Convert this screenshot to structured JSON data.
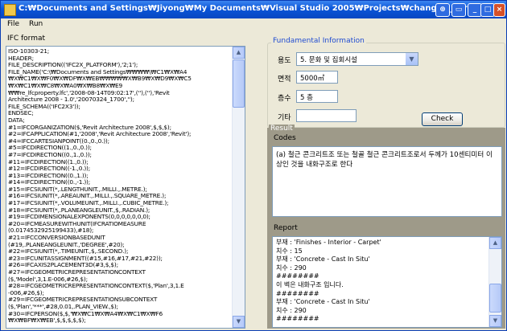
{
  "window": {
    "title": "C:\\Documents and Settings\\Jiyong\\My Documents\\Visual Studio 2005\\Projects\\changed_parame",
    "title_display": "C:₩Documents and Settings₩Jiyong₩My Documents₩Visual Studio 2005₩Projects₩changed_parame"
  },
  "menu": {
    "file": "File",
    "run": "Run"
  },
  "ifc": {
    "label": "IFC format",
    "lines": [
      "ISO-10303-21;",
      "HEADER;",
      "FILE_DESCRIPTION(('IFC2X_PLATFORM'),'2;1');",
      "FILE_NAME('C:\\₩Documents and Settings₩₩₩₩\\₩C1₩X₩A4",
      "₩X₩C1₩X₩F0₩X₩DF₩X₩EB₩₩₩₩₩X₩B9₩X₩D9₩X₩C5",
      "₩X₩C1₩X₩C8₩X₩A0₩X₩B8₩X₩E9",
      "₩₩re_lfcproperty.lfc','2008-08-14T09:02:17',(''),(''),'Revit",
      "Architecture 2008 - 1.0','20070324_1700','');",
      "FILE_SCHEMA(('IFC2X3'));",
      "ENDSEC;",
      "DATA;",
      "#1=IFCORGANIZATION($,'Revit Architecture 2008',$,$,$);",
      "#2=IFCAPPLICATION(#1,'2008','Revit Architecture 2008','Revit');",
      "#4=IFCCARTESIANPOINT((0.,0.,0.));",
      "#5=IFCDIRECTION((1.,0.,0.));",
      "#7=IFCDIRECTION((0.,1.,0.));",
      "#11=IFCDIRECTION((1.,0.));",
      "#12=IFCDIRECTION((-1.,0.));",
      "#13=IFCDIRECTION((0.,1.));",
      "#14=IFCDIRECTION((0.,-1.));",
      "#15=IFCSIUNIT(*,.LENGTHUNIT.,.MILLI.,.METRE.);",
      "#16=IFCSIUNIT(*,.AREAUNIT.,.MILLI.,.SQUARE_METRE.);",
      "#17=IFCSIUNIT(*,.VOLUMEUNIT.,.MILLI.,.CUBIC_METRE.);",
      "#18=IFCSIUNIT(*,.PLANEANGLEUNIT.,$,.RADIAN.);",
      "#19=IFCDIMENSIONALEXPONENTS(0,0,0,0,0,0,0);",
      "#20=IFCMEASUREWITHUNIT(IFCRATIOMEASURE",
      "(0.0174532925199433),#18);",
      "#21=IFCCONVERSIONBASEDUNIT",
      "(#19,.PLANEANGLEUNIT.,'DEGREE',#20);",
      "#22=IFCSIUNIT(*,.TIMEUNIT.,$,.SECOND.);",
      "#23=IFCUNITASSIGNMENT((#15,#16,#17,#21,#22));",
      "#26=IFCAXIS2PLACEMENT3D(#3,$,$);",
      "#27=IFCGEOMETRICREPRESENTATIONCONTEXT",
      "($,'Model',3,1.E-006,#26,$);",
      "#28=IFCGEOMETRICREPRESENTATIONCONTEXT($,'Plan',3,1.E",
      "-006,#26,$);",
      "#29=IFCGEOMETRICREPRESENTATIONSUBCONTEXT",
      "($,'Plan','***',#28,0.01,.PLAN_VIEW.,$);",
      "#30=IFCPERSON($,$,'₩X₩C1₩X₩A4₩X₩C1₩X₩F6",
      "₩X₩BF₩X₩EB',$,$,$,$,$);"
    ]
  },
  "fundamental": {
    "title": "Fundamental Information",
    "use_label": "용도",
    "use_value": "5. 문화 및 집회시설",
    "area_label": "면적",
    "area_value": "5000㎡",
    "floors_label": "층수",
    "floors_value": "5 층",
    "other_label": "기타",
    "other_value": "",
    "check_button": "Check"
  },
  "result": {
    "title": "Result",
    "codes_label": "Codes",
    "codes_text": "(a) 철근 콘크리트조 또는 철골 철근 콘크리트조로서 두께가 10센티미터 이상인 것을 내화구조로 한다",
    "report_label": "Report",
    "report_lines": [
      "부재 : 'Finishes - Interior - Carpet'",
      "치수 : 15",
      "부재 : 'Concrete - Cast In Situ'",
      "치수 : 290",
      "########",
      "이 벽은 내화구조 입니다.",
      "########",
      "부재 : 'Concrete - Cast In Situ'",
      "치수 : 290",
      "########"
    ]
  },
  "colors": {
    "titlebar": "#0a55d8",
    "group_title": "#1f4bd1",
    "result_panel": "#9e9a89",
    "window_bg": "#ece9d8"
  }
}
